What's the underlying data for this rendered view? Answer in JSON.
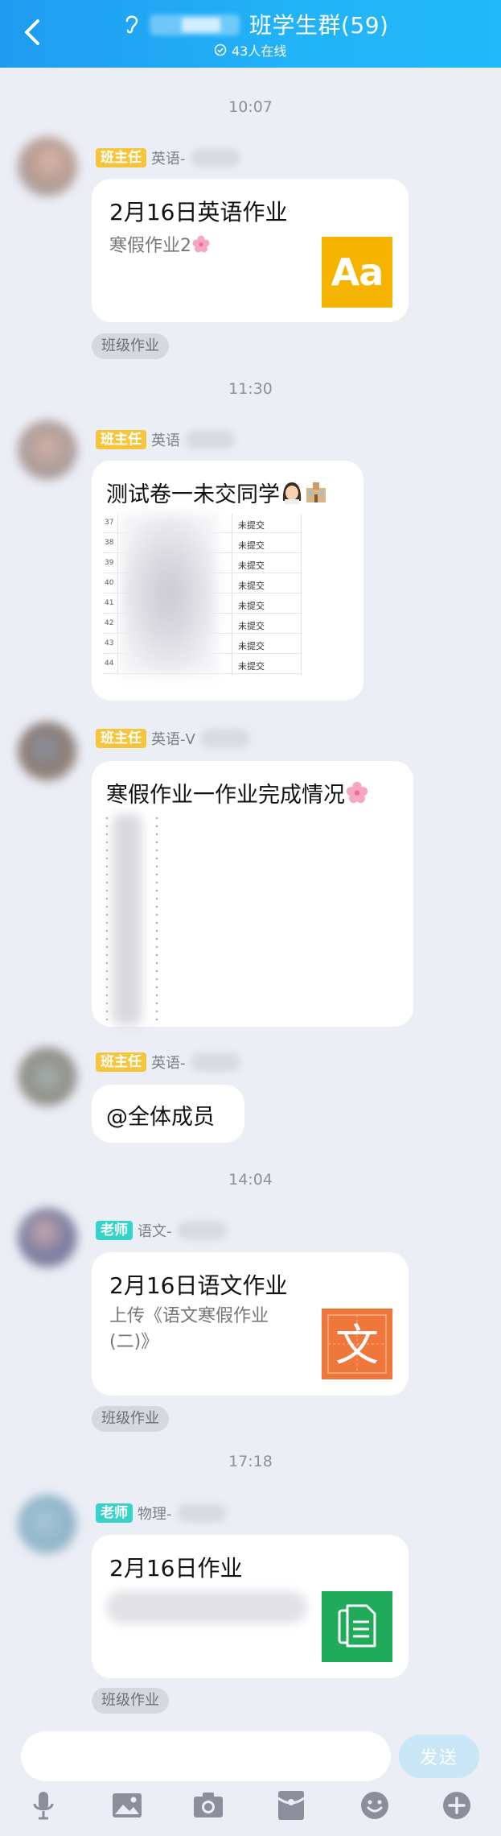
{
  "header": {
    "title": "班学生群(59)",
    "online": "43人在线"
  },
  "messages": [
    {
      "time": "10:07",
      "badge": "班主任",
      "sender": "英语-",
      "title": "2月16日英语作业",
      "subtitle": "寒假作业2",
      "tile": "Aa",
      "tag": "班级作业"
    },
    {
      "time": "11:30",
      "badge": "班主任",
      "sender": "英语",
      "text": "测试卷一未交同学",
      "table_rows": [
        {
          "n": "37",
          "status": "未提交"
        },
        {
          "n": "38",
          "status": "未提交"
        },
        {
          "n": "39",
          "status": "未提交"
        },
        {
          "n": "40",
          "status": "未提交"
        },
        {
          "n": "41",
          "status": "未提交"
        },
        {
          "n": "42",
          "status": "未提交"
        },
        {
          "n": "43",
          "status": "未提交"
        },
        {
          "n": "44",
          "status": "未提交"
        }
      ]
    },
    {
      "badge": "班主任",
      "sender": "英语-V",
      "text": "寒假作业一作业完成情况"
    },
    {
      "badge": "班主任",
      "sender": "英语-",
      "text": "@全体成员"
    },
    {
      "time": "14:04",
      "badge": "老师",
      "sender": "语文-",
      "title": "2月16日语文作业",
      "subtitle": "上传《语文寒假作业(二)》",
      "tile": "文",
      "tag": "班级作业"
    },
    {
      "time": "17:18",
      "badge": "老师",
      "sender": "物理-",
      "title": "2月16日作业",
      "tag": "班级作业"
    }
  ],
  "input": {
    "send_label": "发送"
  },
  "toolbar": [
    "mic-icon",
    "image-icon",
    "camera-icon",
    "red-packet-icon",
    "emoji-icon",
    "plus-icon"
  ],
  "colors": {
    "header": "#1fa8f4",
    "head_teacher_badge": "#f5c53b",
    "teacher_badge": "#37d3c8"
  }
}
